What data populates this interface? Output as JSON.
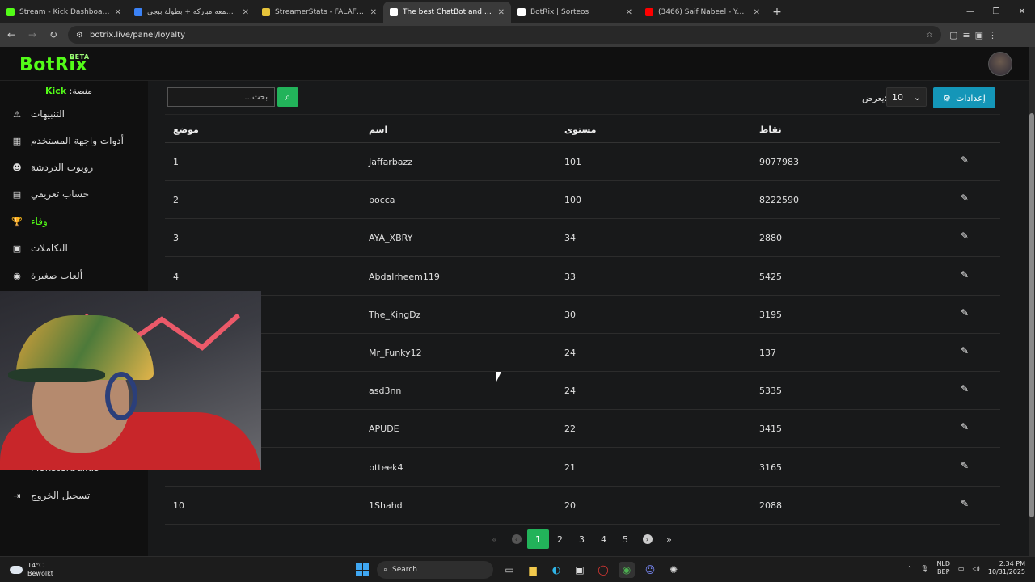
{
  "browser": {
    "tabs": [
      {
        "title": "Stream - Kick Dashboard",
        "color": "#53fc18"
      },
      {
        "title": "جمعه مباركه + بطولة ببجي -im",
        "color": "#3b82f6"
      },
      {
        "title": "StreamerStats - FALAFELCO Pro",
        "color": "#e6c33a"
      },
      {
        "title": "The best ChatBot and Widgets",
        "color": "#ffffff"
      },
      {
        "title": "BotRix | Sorteos",
        "color": "#ffffff"
      },
      {
        "title": "(3466) Saif Nabeel - Ya Mahyou",
        "color": "#ff0000"
      }
    ],
    "active_tab": 3,
    "url": "botrix.live/panel/loyalty"
  },
  "app": {
    "logo": "BotRix",
    "logo_badge": "BETA",
    "platform_label": "منصة:",
    "platform_value": "Kick"
  },
  "sidebar": {
    "items": [
      {
        "label": "التنبيهات",
        "icon": "warning-icon",
        "glyph": "⚠"
      },
      {
        "label": "أدوات واجهة المستخدم",
        "icon": "grid-icon",
        "glyph": "▦"
      },
      {
        "label": "روبوت الدردشة",
        "icon": "robot-icon",
        "glyph": "☻"
      },
      {
        "label": "حساب تعريفي",
        "icon": "id-card-icon",
        "glyph": "▤"
      },
      {
        "label": "وفاء",
        "icon": "trophy-icon",
        "glyph": "🏆"
      },
      {
        "label": "التكاملات",
        "icon": "integrations-icon",
        "glyph": "▣"
      },
      {
        "label": "ألعاب صغيرة",
        "icon": "gamepad-icon",
        "glyph": "◉"
      },
      {
        "label": "Monsterbuilds",
        "icon": "layers-icon",
        "glyph": "≡"
      },
      {
        "label": "تسجيل الخروج",
        "icon": "logout-icon",
        "glyph": "⇥"
      }
    ],
    "active_index": 4
  },
  "controls": {
    "search_placeholder": "...بحث",
    "per_page_label": "يعرض:",
    "per_page_value": "10",
    "settings_label": "إعدادات"
  },
  "table": {
    "headers": {
      "rank": "موضع",
      "name": "اسم",
      "level": "مستوى",
      "points": "نقاط"
    },
    "rows": [
      {
        "rank": "1",
        "name": "Jaffarbazz",
        "level": "101",
        "points": "9077983"
      },
      {
        "rank": "2",
        "name": "pocca",
        "level": "100",
        "points": "8222590"
      },
      {
        "rank": "3",
        "name": "AYA_XBRY",
        "level": "34",
        "points": "2880"
      },
      {
        "rank": "4",
        "name": "Abdalrheem119",
        "level": "33",
        "points": "5425"
      },
      {
        "rank": "",
        "name": "The_KingDz",
        "level": "30",
        "points": "3195"
      },
      {
        "rank": "",
        "name": "Mr_Funky12",
        "level": "24",
        "points": "137"
      },
      {
        "rank": "",
        "name": "asd3nn",
        "level": "24",
        "points": "5335"
      },
      {
        "rank": "",
        "name": "APUDE",
        "level": "22",
        "points": "3415"
      },
      {
        "rank": "",
        "name": "btteek4",
        "level": "21",
        "points": "3165"
      },
      {
        "rank": "10",
        "name": "1Shahd",
        "level": "20",
        "points": "2088"
      }
    ]
  },
  "pagination": {
    "pages": [
      "1",
      "2",
      "3",
      "4",
      "5"
    ],
    "current": "1"
  },
  "taskbar": {
    "temperature": "14°C",
    "weather": "Bewolkt",
    "search_label": "Search",
    "lang_top": "NLD",
    "lang_bottom": "BEP",
    "time": "2:34 PM",
    "date": "10/31/2025"
  }
}
